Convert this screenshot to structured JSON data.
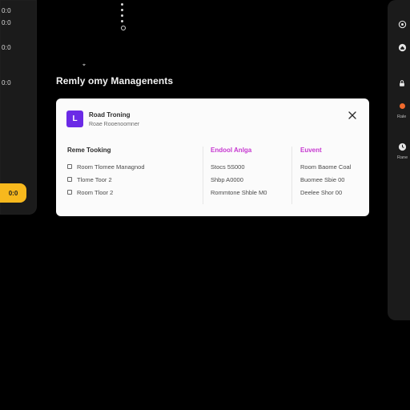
{
  "left_panel": {
    "stats": [
      "0:0",
      "0:0",
      "0:0",
      "0:0"
    ],
    "cta_label": "0:0"
  },
  "page": {
    "title": "Remly omy Managenents"
  },
  "modal": {
    "icon_glyph": "L",
    "title": "Road Troning",
    "subtitle": "Roae Rooenoomner",
    "close_label": "close",
    "columns": [
      {
        "header": "Reme Tooking",
        "rows": [
          "Room Tlomee Managnod",
          "Tlome Toor 2",
          "Room Tloor 2"
        ]
      },
      {
        "header": "Endool Anlga",
        "rows": [
          "Stocs 5S000",
          "Shbp A0000",
          "Rommtone Shble M0"
        ]
      },
      {
        "header": "Euvent",
        "rows": [
          "Room Baome Coal",
          "Buomee Sbie 00",
          "Deelee Shor 00"
        ]
      }
    ]
  },
  "right_panel": {
    "items": [
      {
        "icon": "settings-icon",
        "label": ""
      },
      {
        "icon": "home-icon",
        "label": ""
      },
      {
        "icon": "lock-icon",
        "label": ""
      },
      {
        "icon": "status-dot-icon",
        "label": "Rale"
      },
      {
        "icon": "clock-icon",
        "label": "Rane"
      }
    ]
  },
  "colors": {
    "background": "#000000",
    "panel": "#1b1b1b",
    "accent_purple": "#6b2ae6",
    "accent_pink": "#c637d0",
    "accent_yellow": "#f7b81d",
    "accent_orange": "#f06a2d",
    "card": "#fbfbfb"
  }
}
